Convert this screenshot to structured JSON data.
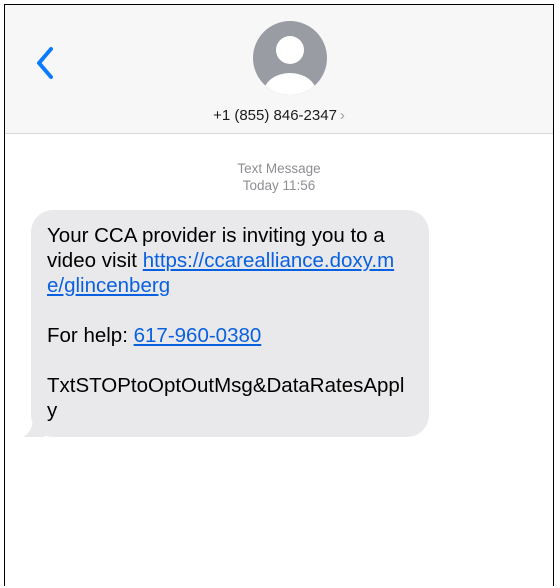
{
  "header": {
    "contact_number": "+1 (855) 846-2347",
    "contact_chevron": "›",
    "back_icon": "chevron-left-icon",
    "avatar_icon": "person-avatar-icon"
  },
  "thread": {
    "service_label": "Text Message",
    "timestamp": "Today 11:56"
  },
  "message": {
    "intro": "Your CCA provider is inviting you to a video visit ",
    "video_link": "https://ccarealliance.doxy.me/glincenberg",
    "help_prefix": "For help: ",
    "help_phone": "617-960-0380",
    "opt_out": "TxtSTOPtoOptOutMsg&DataRatesApply"
  },
  "colors": {
    "accent": "#0a61e0",
    "bubble": "#e9e9eb",
    "header_bg": "#f7f7f8",
    "meta_text": "#8e8e93"
  }
}
